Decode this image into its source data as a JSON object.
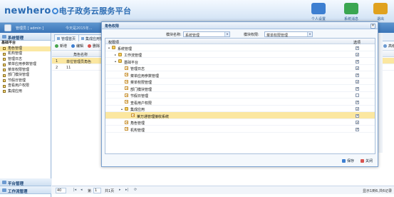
{
  "header": {
    "logo_en": "newhero",
    "logo_cn": "电子政务云服务平台",
    "icons": [
      {
        "name": "personal-settings-icon",
        "label": "个人设置",
        "color": "#3d7fd1"
      },
      {
        "name": "system-message-icon",
        "label": "系统消息",
        "color": "#3aa651"
      },
      {
        "name": "exit-icon",
        "label": "退出",
        "color": "#e0a21f"
      }
    ]
  },
  "userbar": {
    "user_text": "管理员 [ admin ]",
    "welcome": "今天是2015年..."
  },
  "sidebar": {
    "head": "系统管理",
    "items": [
      {
        "label": "基础平台",
        "root": true
      },
      {
        "label": "角色管理",
        "selected": true
      },
      {
        "label": "机构管理"
      },
      {
        "label": "管理日志"
      },
      {
        "label": "菜单应用参数管理"
      },
      {
        "label": "菜单权限管理"
      },
      {
        "label": "部门模块管理"
      },
      {
        "label": "节假日管理"
      },
      {
        "label": "查看用户权限"
      },
      {
        "label": "集成应用"
      }
    ],
    "bottom_panels": [
      "平台管理",
      "工作流管理"
    ]
  },
  "content": {
    "tabs": [
      "管理首页",
      "集成应用管理"
    ],
    "toolbar": [
      "新增",
      "编辑",
      "删除"
    ],
    "extra_tool": "高级",
    "grid_header": "角色名称",
    "rows": [
      {
        "num": "1",
        "name": "单位管理员角色",
        "selected": true
      },
      {
        "num": "2",
        "name": "11",
        "selected": false
      }
    ],
    "pager": {
      "page_size": "40",
      "page_label": "第",
      "page_num": "1",
      "page_total": "共1页",
      "info": "显示1到6,共6记录"
    }
  },
  "modal": {
    "title": "角色权限",
    "close": "×",
    "module_label": "模块名称:",
    "module_value": "系统管理",
    "perm_label": "模块权限:",
    "perm_value": "菜单权限管理",
    "col_perm": "权限项",
    "col_check": "选项",
    "tree": [
      {
        "label": "系统管理",
        "level": 0,
        "type": "folder",
        "toggle": "▴",
        "checked": true
      },
      {
        "label": "工作流管理",
        "level": 1,
        "type": "folder",
        "toggle": "▸",
        "checked": true
      },
      {
        "label": "基础平台",
        "level": 1,
        "type": "folder",
        "toggle": "▴",
        "checked": true
      },
      {
        "label": "管理日志",
        "level": 2,
        "type": "page",
        "checked": true
      },
      {
        "label": "菜单应用参数管理",
        "level": 2,
        "type": "page",
        "checked": true
      },
      {
        "label": "菜单权限管理",
        "level": 2,
        "type": "page",
        "checked": true
      },
      {
        "label": "部门模块管理",
        "level": 2,
        "type": "page",
        "checked": true
      },
      {
        "label": "节假日管理",
        "level": 2,
        "type": "page",
        "checked": false
      },
      {
        "label": "查看用户权限",
        "level": 2,
        "type": "page",
        "checked": true
      },
      {
        "label": "集成应用",
        "level": 2,
        "type": "folder",
        "toggle": "▴",
        "checked": true
      },
      {
        "label": "莱万通管理接收系统",
        "level": 3,
        "type": "page",
        "checked": true,
        "selected": true
      },
      {
        "label": "角色管理",
        "level": 2,
        "type": "page",
        "checked": true
      },
      {
        "label": "机构管理",
        "level": 2,
        "type": "page",
        "checked": true
      }
    ],
    "save_label": "保存",
    "close_label": "关闭"
  }
}
